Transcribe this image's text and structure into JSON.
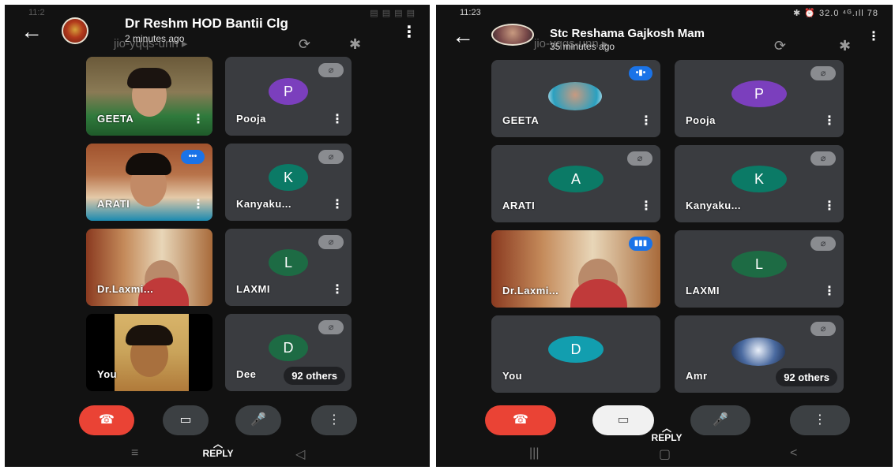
{
  "left": {
    "status_time": "11:2",
    "status_right": "▤ ▤ ▤ ▤",
    "chat_name": "Dr Reshm HOD Bantii Clg",
    "chat_sub": "2 minutes ago",
    "faded_meet": "jio-yqqs-unn ▸",
    "tiles": [
      {
        "name": "GEETA",
        "kind": "photo"
      },
      {
        "name": "Pooja",
        "letter": "P",
        "color": "#7b3fbd"
      },
      {
        "name": "ARATI",
        "kind": "photo"
      },
      {
        "name": "Kanyaku...",
        "letter": "K",
        "color": "#0b7a66"
      },
      {
        "name": "Dr.Laxmi...",
        "kind": "photo"
      },
      {
        "name": "LAXMI",
        "letter": "L",
        "color": "#1d6b44"
      },
      {
        "name": "You",
        "kind": "photo"
      },
      {
        "name": "Dee",
        "letter": "D",
        "color": "#1d6b44"
      }
    ],
    "others": "92 others",
    "reply": "REPLY"
  },
  "right": {
    "status_time": "11:23",
    "status_right": "✱ ⏰ 32.0 ⁴ᴳ.ıll 78",
    "chat_name": "Stc Reshama Gajkosh Mam",
    "chat_sub": "35 minutes ago",
    "faded_meet": "jio-yqqs-unn ▸",
    "tiles": [
      {
        "name": "GEETA",
        "kind": "avatar"
      },
      {
        "name": "Pooja",
        "letter": "P",
        "color": "#7b3fbd"
      },
      {
        "name": "ARATI",
        "letter": "A",
        "color": "#0b7a66"
      },
      {
        "name": "Kanyaku...",
        "letter": "K",
        "color": "#0b7a66"
      },
      {
        "name": "Dr.Laxmi...",
        "kind": "photo"
      },
      {
        "name": "LAXMI",
        "letter": "L",
        "color": "#1d6b44"
      },
      {
        "name": "You",
        "letter": "D",
        "color": "#129eaf"
      },
      {
        "name": "Amr",
        "kind": "avatar"
      }
    ],
    "others": "92 others",
    "reply": "REPLY"
  },
  "icons": {
    "back": "←",
    "kebab": "⋮",
    "mute": "🎙̸",
    "end_call": "☎",
    "camera": "▭",
    "mic": "🎤",
    "more": "⋮",
    "bluetooth": "✱",
    "rotate": "⟳"
  }
}
